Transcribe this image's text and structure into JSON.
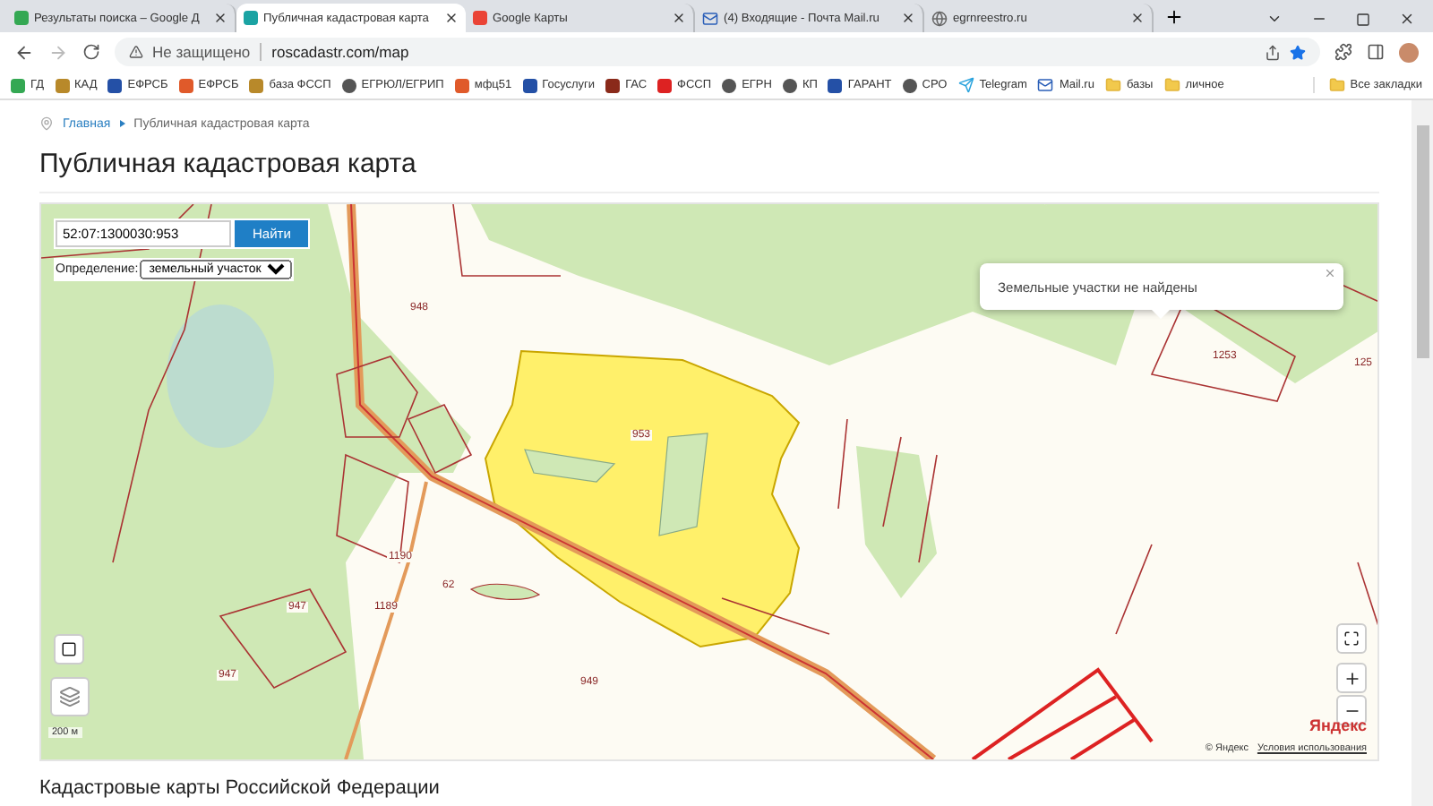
{
  "tabs": [
    {
      "title": "Результаты поиска – Google Д",
      "selected": false,
      "kind": "drive"
    },
    {
      "title": "Публичная кадастровая карта",
      "selected": true,
      "kind": "site"
    },
    {
      "title": "Google Карты",
      "selected": false,
      "kind": "maps"
    },
    {
      "title": "(4) Входящие - Почта Mail.ru",
      "selected": false,
      "kind": "mail"
    },
    {
      "title": "egrnreestro.ru",
      "selected": false,
      "kind": "globe"
    }
  ],
  "address_bar": {
    "security": "Не защищено",
    "url": "roscadastr.com/map",
    "bookmarked": true
  },
  "bookmarks": [
    {
      "label": "ГД",
      "kind": "drive"
    },
    {
      "label": "КАД",
      "kind": "emblem"
    },
    {
      "label": "ЕФРСБ",
      "kind": "flag"
    },
    {
      "label": "ЕФРСБ",
      "kind": "fire"
    },
    {
      "label": "база ФССП",
      "kind": "emblem"
    },
    {
      "label": "ЕГРЮЛ/ЕГРИП",
      "kind": "circle"
    },
    {
      "label": "мфц51",
      "kind": "fire"
    },
    {
      "label": "Госуслуги",
      "kind": "flag"
    },
    {
      "label": "ГАС",
      "kind": "square"
    },
    {
      "label": "ФССП",
      "kind": "arrow"
    },
    {
      "label": "ЕГРН",
      "kind": "circle"
    },
    {
      "label": "КП",
      "kind": "circle"
    },
    {
      "label": "ГАРАНТ",
      "kind": "flag"
    },
    {
      "label": "СРО",
      "kind": "circle"
    },
    {
      "label": "Telegram",
      "kind": "telegram"
    },
    {
      "label": "Mail.ru",
      "kind": "mail"
    },
    {
      "label": "базы",
      "kind": "folder"
    },
    {
      "label": "личное",
      "kind": "folder"
    }
  ],
  "all_bookmarks": "Все закладки",
  "breadcrumb": [
    "Главная",
    "Публичная кадастровая карта"
  ],
  "page_title": "Публичная кадастровая карта",
  "map": {
    "search_value": "52:07:1300030:953",
    "search_button": "Найти",
    "definition_label": "Определение:",
    "definition_value": "земельный участок",
    "popup": "Земельные участки не найдены",
    "parcel_labels": [
      "948",
      "953",
      "1253",
      "125",
      "1190",
      "1189",
      "62",
      "947",
      "947",
      "949"
    ],
    "scale": "200 м",
    "provider": "Яндекс",
    "copyright": "© Яндекс",
    "terms": "Условия использования"
  },
  "section_heading": "Кадастровые карты Российской Федерации"
}
